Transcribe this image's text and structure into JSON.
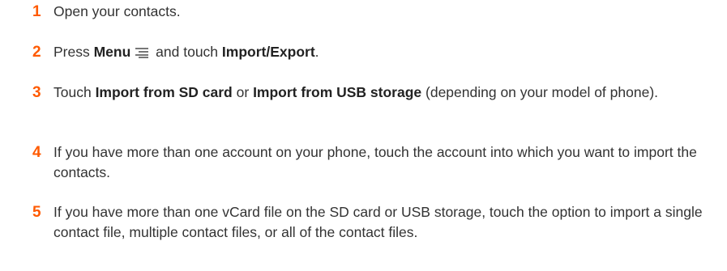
{
  "steps": [
    {
      "number": "1",
      "text": "Open your contacts."
    },
    {
      "number": "2",
      "part1": "Press ",
      "bold1": "Menu",
      "icon": "menu-icon",
      "part2": " and touch ",
      "bold2": "Import/Export",
      "part3": "."
    },
    {
      "number": "3",
      "part1": "Touch ",
      "bold1": "Import from SD card",
      "part2": " or ",
      "bold2": "Import from USB storage",
      "part3": " (depending on your model of phone)."
    },
    {
      "number": "4",
      "text": "If you have more than one account on your phone, touch the account into which you want to import the contacts."
    },
    {
      "number": "5",
      "text": "If you have more than one vCard file on the SD card or USB storage, touch the option to import a single contact file, multiple contact files, or all of the contact files."
    }
  ],
  "colors": {
    "step_number": "#ff5a00",
    "body_text": "#333333"
  }
}
